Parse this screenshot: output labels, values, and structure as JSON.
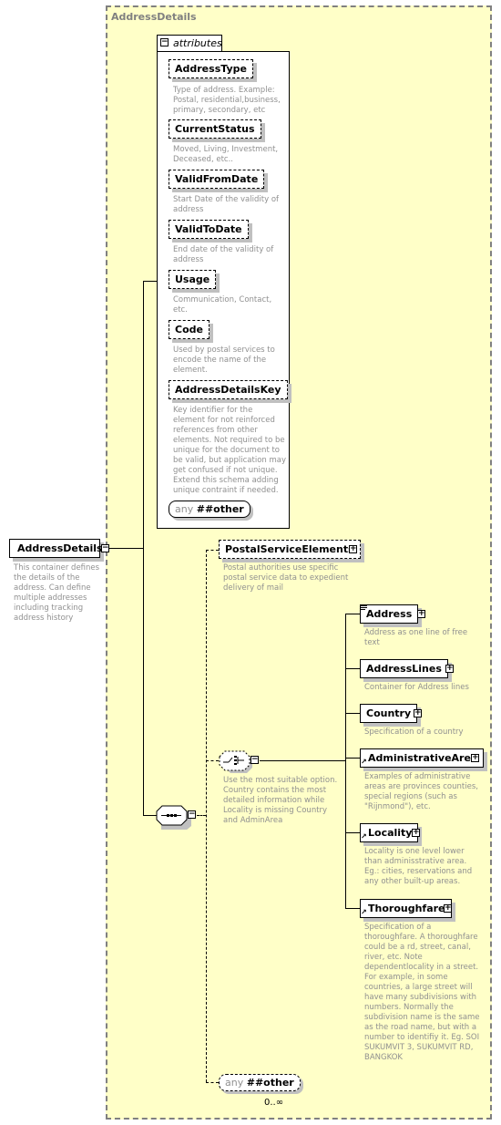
{
  "root": {
    "name": "AddressDetails",
    "description": "This container defines the details of the address. Can define multiple addresses including tracking address history",
    "toggle": "−"
  },
  "container": {
    "title": "AddressDetails"
  },
  "attributes": {
    "label": "attributes",
    "toggle": "−",
    "items": [
      {
        "name": "AddressType",
        "description": "Type of address. Example: Postal, residential,business, primary, secondary, etc"
      },
      {
        "name": "CurrentStatus",
        "description": "Moved, Living, Investment, Deceased, etc.."
      },
      {
        "name": "ValidFromDate",
        "description": "Start Date of the validity of address"
      },
      {
        "name": "ValidToDate",
        "description": "End date of the validity of address"
      },
      {
        "name": "Usage",
        "description": "Communication, Contact, etc."
      },
      {
        "name": "Code",
        "description": "Used by postal services to encode the name of the element."
      },
      {
        "name": "AddressDetailsKey",
        "description": "Key identifier for the element for not reinforced references from other elements. Not required to be unique for the document to be valid, but application may get confused if not unique. Extend this schema adding unique contraint if needed."
      }
    ],
    "any": {
      "keyword": "any",
      "value": "##other"
    }
  },
  "sequence": {
    "toggle": "−"
  },
  "postal": {
    "name": "PostalServiceElements",
    "description": "Postal authorities use specific postal service data to expedient delivery of mail",
    "toggle": "+"
  },
  "choice": {
    "description": "Use the most suitable option. Country contains the most detailed information while Locality is missing Country and AdminArea",
    "toggle": "−"
  },
  "choices": [
    {
      "name": "Address",
      "description": "Address as one line of free text",
      "toggle": "+"
    },
    {
      "name": "AddressLines",
      "description": "Container for Address lines",
      "toggle": "+"
    },
    {
      "name": "Country",
      "description": "Specification of a country",
      "toggle": "+"
    },
    {
      "name": "AdministrativeArea",
      "description": "Examples of administrative areas are provinces counties, special regions (such as \"Rijnmond\"), etc.",
      "toggle": "+"
    },
    {
      "name": "Locality",
      "description": "Locality is one level lower than adminisstrative area. Eg.: cities, reservations and any other built-up areas.",
      "toggle": "+"
    },
    {
      "name": "Thoroughfare",
      "description": "Specification of a thoroughfare. A thoroughfare could be a rd, street, canal, river, etc.  Note dependentlocality in a street. For example, in some countries, a large street will have many subdivisions with numbers. Normally the subdivision name is the same as the road name, but with a number to identifiy it. Eg. SOI SUKUMVIT 3, SUKUMVIT RD, BANGKOK",
      "toggle": "+"
    }
  ],
  "any_other": {
    "keyword": "any",
    "value": "##other",
    "cardinality": "0..∞"
  }
}
